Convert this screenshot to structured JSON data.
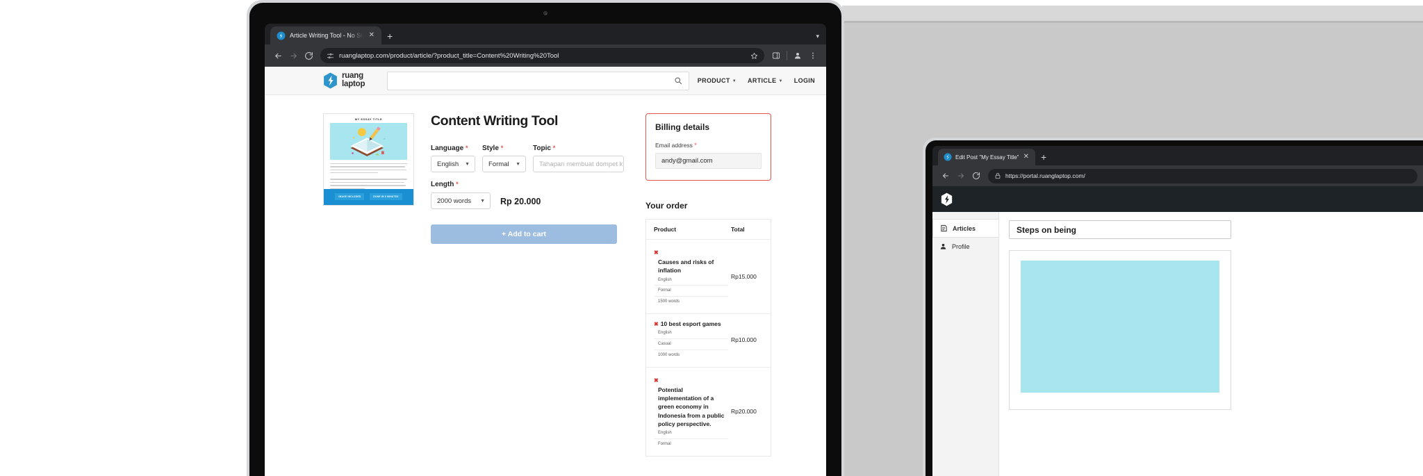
{
  "browser": {
    "tab": {
      "title": "Article Writing Tool - No Sign",
      "favicon": "ruanglaptop-favicon",
      "close_label": "✕",
      "new_tab_label": "+"
    },
    "toolbar": {
      "back_label": "←",
      "forward_label": "→",
      "reload_label": "↻",
      "site_info_icon": "tune-icon",
      "url": "ruanglaptop.com/product/article/?product_title=Content%20Writing%20Tool",
      "star_icon": "bookmark-star-icon",
      "split_icon": "side-panel-icon",
      "profile_icon": "profile-avatar-icon",
      "menu_icon": "three-dot-menu-icon"
    }
  },
  "site": {
    "logo": {
      "line1": "ruang",
      "line2": "laptop"
    },
    "search": {
      "value": "",
      "placeholder": ""
    },
    "nav": [
      {
        "label": "PRODUCT",
        "has_caret": true
      },
      {
        "label": "ARTICLE",
        "has_caret": true
      },
      {
        "label": "LOGIN",
        "has_caret": false
      }
    ]
  },
  "product": {
    "card": {
      "title": "MY ESSAY TITLE",
      "chips": [
        "IMAGE INCLUDED",
        "DONE IN 5 MINUTES"
      ]
    },
    "heading": "Content Writing Tool",
    "fields": {
      "language": {
        "label": "Language",
        "required": "*",
        "value": "English"
      },
      "style": {
        "label": "Style",
        "required": "*",
        "value": "Formal"
      },
      "topic": {
        "label": "Topic",
        "required": "*",
        "value": "",
        "placeholder": "Tahapan membuat dompet kul"
      },
      "length": {
        "label": "Length",
        "required": "*",
        "value": "2000 words"
      }
    },
    "price": "Rp 20.000",
    "add_to_cart": "+ Add to cart"
  },
  "billing": {
    "heading": "Billing details",
    "email_label": "Email address",
    "email_required": "*",
    "email_value": "andy@gmail.com"
  },
  "order": {
    "heading": "Your order",
    "columns": [
      "Product",
      "Total"
    ],
    "rows": [
      {
        "remove_label": "✖",
        "name": "Causes and risks of inflation",
        "meta": [
          "English",
          "Formal",
          "1500 words"
        ],
        "total": "Rp15.000"
      },
      {
        "remove_label": "✖",
        "name": "10 best esport games",
        "meta": [
          "English",
          "Casual",
          "1000 words"
        ],
        "total": "Rp10.000"
      },
      {
        "remove_label": "✖",
        "name": "Potential implementation of a green economy in Indonesia from a public policy perspective.",
        "meta": [
          "English",
          "Formal"
        ],
        "total": "Rp20.000"
      }
    ]
  },
  "tablet": {
    "tab": {
      "title": "Edit Post \"My Essay Title\"",
      "close_label": "✕",
      "new_tab_label": "+"
    },
    "toolbar": {
      "back_label": "←",
      "forward_label": "→",
      "reload_label": "↻",
      "lock_icon": "lock-icon",
      "url": "https://portal.ruanglaptop.com/"
    },
    "sidebar": [
      {
        "label": "Articles",
        "icon": "articles-icon",
        "active": true
      },
      {
        "label": "Profile",
        "icon": "user-icon",
        "active": false
      }
    ],
    "post_title": "Steps on being"
  }
}
